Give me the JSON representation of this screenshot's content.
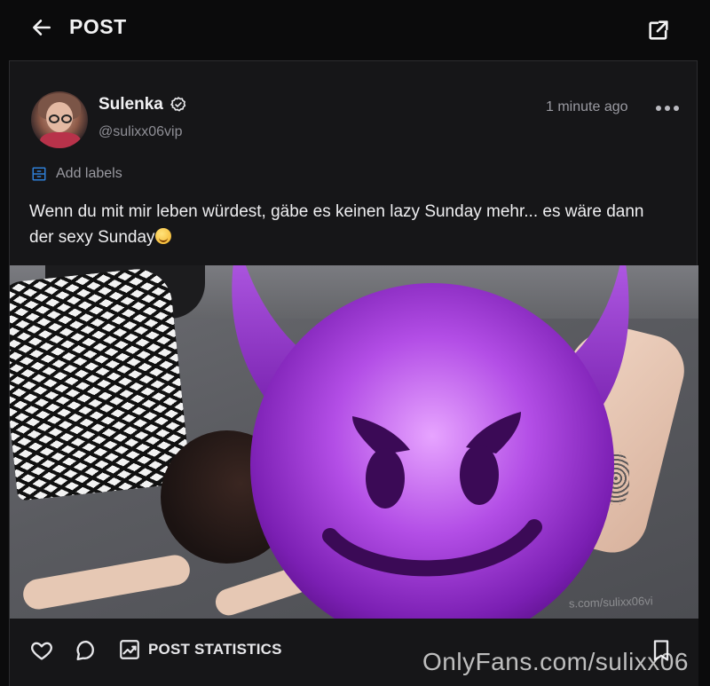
{
  "header": {
    "title": "POST"
  },
  "post": {
    "author": {
      "name": "Sulenka",
      "handle": "@sulixx06vip"
    },
    "time": "1 minute ago",
    "add_labels": "Add labels",
    "caption_text": "Wenn du mit mir leben würdest, gäbe es keinen lazy Sunday mehr... es wäre dann der sexy Sunday"
  },
  "actions": {
    "stats_label": "POST STATISTICS"
  },
  "media": {
    "inline_watermark": "s.com/sulixx06vi"
  },
  "watermark": "OnlyFans.com/sulixx06",
  "colors": {
    "background": "#0b0b0c",
    "panel": "#161618",
    "muted": "#9a9aa1",
    "accent": "#2f7fd6"
  },
  "icons": {
    "back": "arrow-left-icon",
    "share": "share-icon",
    "verified": "verified-badge-icon",
    "more": "more-dots-icon",
    "labels": "label-icon",
    "like": "heart-icon",
    "comment": "comment-icon",
    "stats": "chart-icon",
    "bookmark": "bookmark-icon"
  }
}
